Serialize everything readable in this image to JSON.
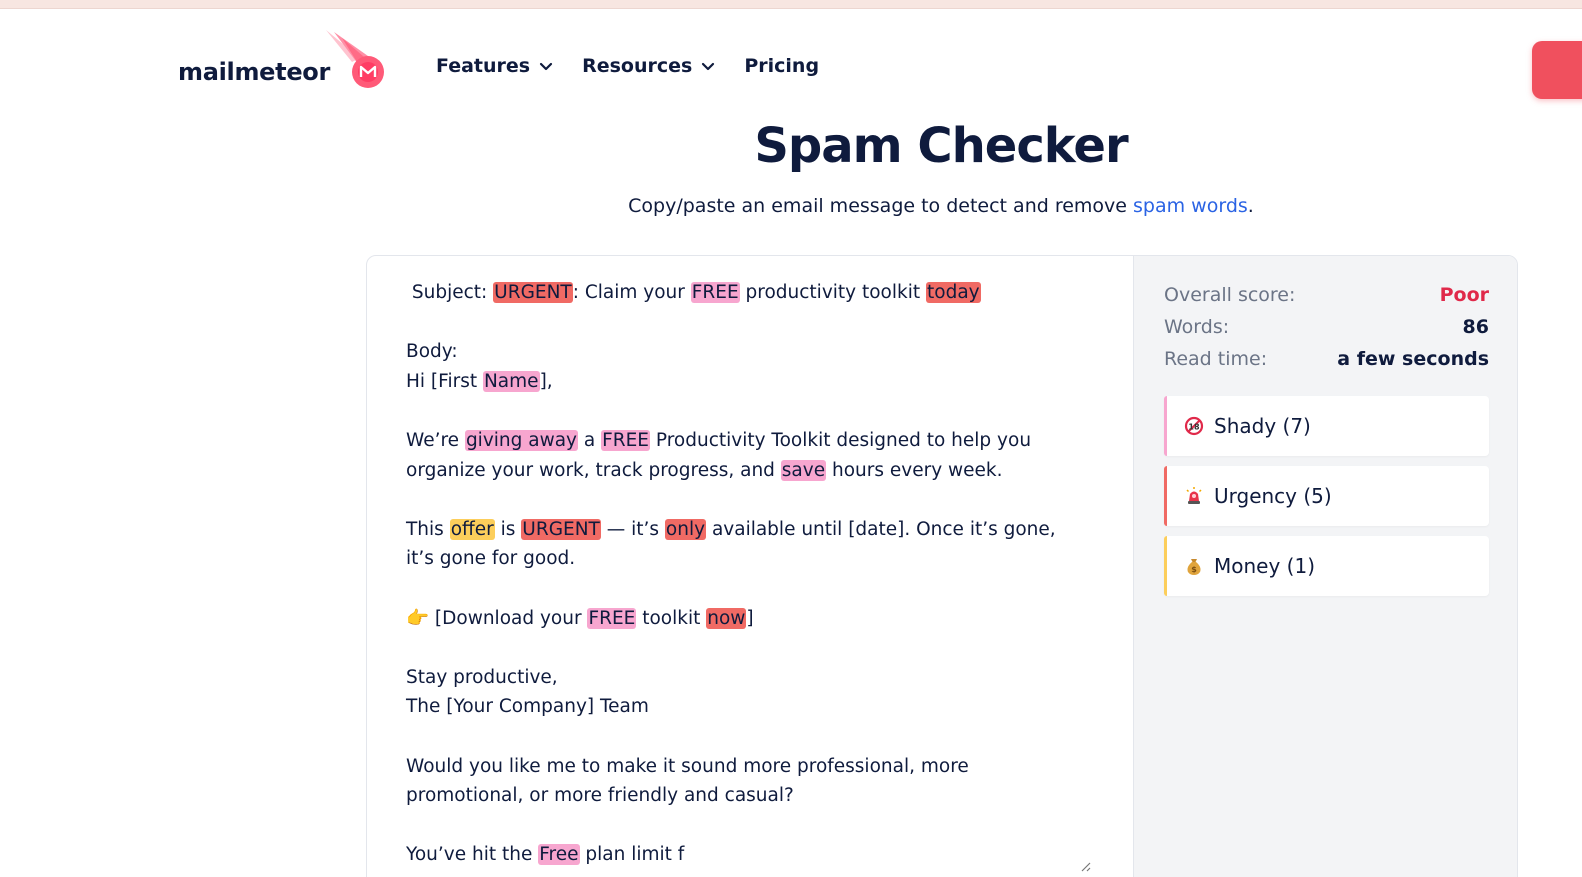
{
  "header": {
    "logo_text": "mailmeteor",
    "nav": [
      {
        "label": "Features",
        "has_dropdown": true
      },
      {
        "label": "Resources",
        "has_dropdown": true
      },
      {
        "label": "Pricing",
        "has_dropdown": false
      }
    ],
    "brand_color": "#f0505e"
  },
  "hero": {
    "title": "Spam Checker",
    "subtitle_before": "Copy/paste an email message to detect and remove ",
    "subtitle_link": "spam words",
    "subtitle_after": "."
  },
  "editor": {
    "lines": [
      [
        {
          "t": " Subject: "
        },
        {
          "t": "URGENT",
          "h": "red"
        },
        {
          "t": ": Claim your "
        },
        {
          "t": "FREE",
          "h": "pink"
        },
        {
          "t": " productivity toolkit "
        },
        {
          "t": "today",
          "h": "red"
        }
      ],
      [
        {
          "t": ""
        }
      ],
      [
        {
          "t": "Body:"
        }
      ],
      [
        {
          "t": "Hi [First "
        },
        {
          "t": "Name",
          "h": "pink"
        },
        {
          "t": "],"
        }
      ],
      [
        {
          "t": ""
        }
      ],
      [
        {
          "t": "We’re "
        },
        {
          "t": "giving away",
          "h": "pink"
        },
        {
          "t": " a "
        },
        {
          "t": "FREE",
          "h": "pink"
        },
        {
          "t": " Productivity Toolkit designed to help you"
        }
      ],
      [
        {
          "t": "organize your work, track progress, and "
        },
        {
          "t": "save",
          "h": "pink"
        },
        {
          "t": " hours every week."
        }
      ],
      [
        {
          "t": ""
        }
      ],
      [
        {
          "t": "This "
        },
        {
          "t": "offer",
          "h": "yellow"
        },
        {
          "t": " is "
        },
        {
          "t": "URGENT",
          "h": "red"
        },
        {
          "t": " — it’s "
        },
        {
          "t": "only",
          "h": "red"
        },
        {
          "t": " available until [date]. Once it’s gone,"
        }
      ],
      [
        {
          "t": "it’s gone for good."
        }
      ],
      [
        {
          "t": ""
        }
      ],
      [
        {
          "t": "👉 [Download your "
        },
        {
          "t": "FREE",
          "h": "pink"
        },
        {
          "t": " toolkit "
        },
        {
          "t": "now",
          "h": "red"
        },
        {
          "t": "]"
        }
      ],
      [
        {
          "t": ""
        }
      ],
      [
        {
          "t": "Stay productive,"
        }
      ],
      [
        {
          "t": "The [Your Company] Team"
        }
      ],
      [
        {
          "t": ""
        }
      ],
      [
        {
          "t": "Would you like me to make it sound more professional, more"
        }
      ],
      [
        {
          "t": "promotional, or more friendly and casual?"
        }
      ],
      [
        {
          "t": ""
        }
      ],
      [
        {
          "t": "You’ve hit the "
        },
        {
          "t": "Free",
          "h": "pink"
        },
        {
          "t": " plan limit f"
        }
      ]
    ],
    "highlight_colors": {
      "red": "#f06a64",
      "pink": "#f7a6cf",
      "yellow": "#fcce5b"
    }
  },
  "results": {
    "overall_score_label": "Overall score:",
    "overall_score_value": "Poor",
    "words_label": "Words:",
    "words_value": "86",
    "read_time_label": "Read time:",
    "read_time_value": "a few seconds",
    "categories": [
      {
        "label": "Shady (7)",
        "icon": "no-entry-18-icon",
        "color": "#f7a6cf"
      },
      {
        "label": "Urgency (5)",
        "icon": "siren-icon",
        "color": "#f06a64"
      },
      {
        "label": "Money (1)",
        "icon": "money-bag-icon",
        "color": "#fcce5b"
      }
    ]
  }
}
